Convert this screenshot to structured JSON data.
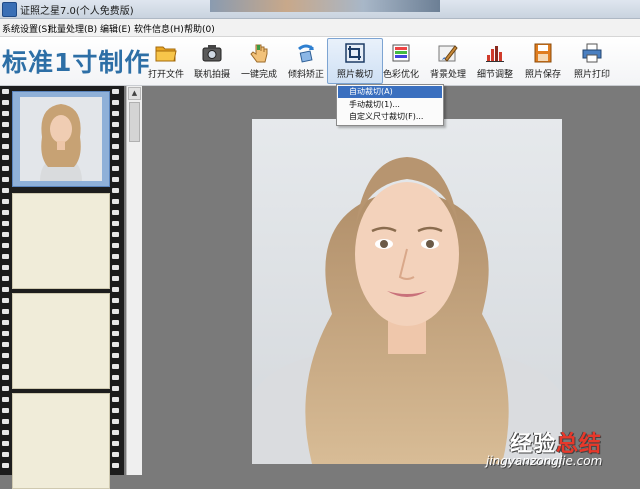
{
  "window": {
    "title": "证照之星7.0(个人免费版)"
  },
  "menu": [
    {
      "label": "系统设置(S)"
    },
    {
      "label": "批量处理(B)"
    },
    {
      "label": "编辑(E)"
    },
    {
      "label": "软件信息(H)"
    },
    {
      "label": "帮助(0)"
    }
  ],
  "banner_title": "标准1寸制作",
  "toolbar": [
    {
      "label": "打开文件",
      "icon": "folder-icon"
    },
    {
      "label": "联机拍摄",
      "icon": "camera-icon"
    },
    {
      "label": "一键完成",
      "icon": "hand-icon"
    },
    {
      "label": "倾斜矫正",
      "icon": "rotate-icon"
    },
    {
      "label": "照片裁切",
      "icon": "crop-icon",
      "active": true
    },
    {
      "label": "色彩优化",
      "icon": "color-icon"
    },
    {
      "label": "背景处理",
      "icon": "brush-icon"
    },
    {
      "label": "细节调整",
      "icon": "levels-icon"
    },
    {
      "label": "照片保存",
      "icon": "save-icon"
    },
    {
      "label": "照片打印",
      "icon": "printer-icon"
    }
  ],
  "crop_menu": [
    {
      "label": "自动裁切(A)",
      "selected": true
    },
    {
      "label": "手动裁切(1)..."
    },
    {
      "label": "自定义尺寸裁切(F)..."
    }
  ],
  "watermark": {
    "brand": "经验总结",
    "brand_accent": "总结",
    "url": "jingyanzongjie.com"
  },
  "colors": {
    "accent": "#2d6fa6",
    "selection": "#3a6fbf",
    "workspace": "#7a7a7a"
  }
}
